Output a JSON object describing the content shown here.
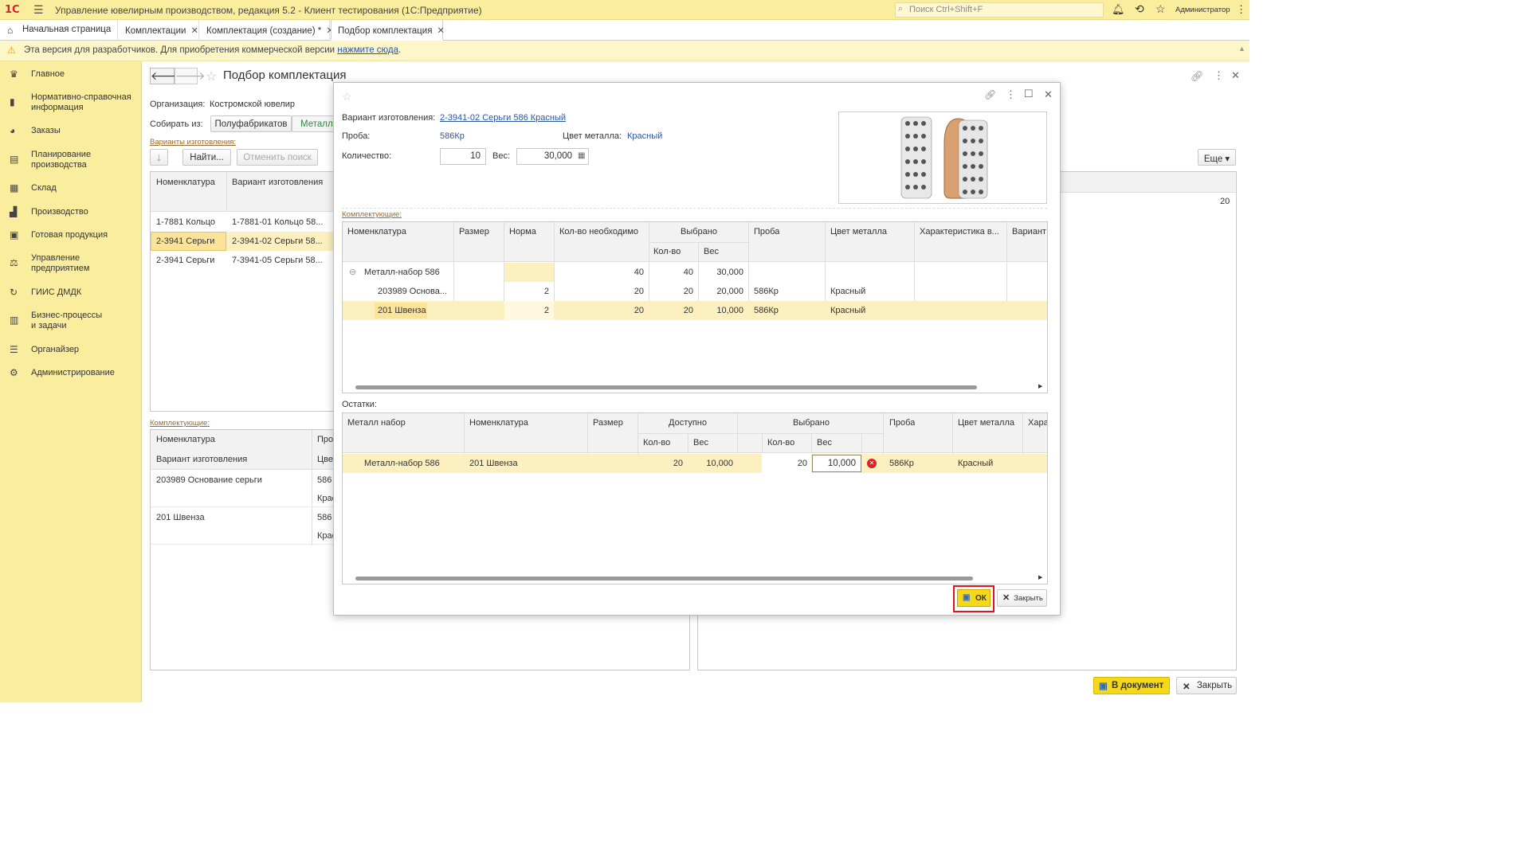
{
  "app": {
    "logo": "1С",
    "title": "Управление ювелирным производством, редакция 5.2  - Клиент тестирования (1С:Предприятие)",
    "search_placeholder": "Поиск Ctrl+Shift+F",
    "user": "Администратор"
  },
  "tabs": [
    {
      "label": "Начальная страница"
    },
    {
      "label": "Комплектации"
    },
    {
      "label": "Комплектация (создание) *"
    },
    {
      "label": "Подбор комплектация"
    }
  ],
  "warning": {
    "text": "Эта версия для разработчиков. Для приобретения коммерческой версии ",
    "link": "нажмите сюда",
    "end": "."
  },
  "sidebar": {
    "items": [
      {
        "label": "Главное",
        "icon": "crown-icon"
      },
      {
        "label": "Нормативно-справочная информация",
        "icon": "book-icon"
      },
      {
        "label": "Заказы",
        "icon": "pie-icon"
      },
      {
        "label": "Планирование производства",
        "icon": "clipboard-icon"
      },
      {
        "label": "Склад",
        "icon": "grid-icon"
      },
      {
        "label": "Производство",
        "icon": "factory-icon"
      },
      {
        "label": "Готовая продукция",
        "icon": "bag-icon"
      },
      {
        "label": "Управление предприятием",
        "icon": "org-icon"
      },
      {
        "label": "ГИИС ДМДК",
        "icon": "sync-icon"
      },
      {
        "label": "Бизнес-процессы и задачи",
        "icon": "tasks-icon"
      },
      {
        "label": "Органайзер",
        "icon": "list-icon"
      },
      {
        "label": "Администрирование",
        "icon": "gear-icon"
      }
    ]
  },
  "form": {
    "title": "Подбор комплектация",
    "org_label": "Организация:",
    "org_value": "Костромской ювелир",
    "collect_label": "Собирать из:",
    "collect_tab1": "Полуфабрикатов",
    "collect_tab2": "Металл-",
    "variants_label": "Варианты изготовления:",
    "find_btn": "Найти...",
    "cancel_search_btn": "Отменить поиск",
    "more_btn": "Еще",
    "variants_cols": [
      "Номенклатура",
      "Вариант изготовления"
    ],
    "variants_rows": [
      [
        "1-7881 Кольцо",
        "1-7881-01 Кольцо 58..."
      ],
      [
        "2-3941 Серьги",
        "2-3941-02 Серьги 58..."
      ],
      [
        "2-3941 Серьги",
        "7-3941-05 Серьги 58..."
      ]
    ],
    "components_label": "Комплектующие:",
    "comp_cols": [
      "Номенклатура",
      "Про"
    ],
    "comp_sub": [
      "Вариант изготовления",
      "Цвет"
    ],
    "comp_rows": [
      [
        "203989 Основание серьги",
        "586",
        "Крас"
      ],
      [
        "201 Швенза",
        "586",
        "Крас"
      ]
    ],
    "right_value": "20",
    "to_doc_btn": "В документ",
    "close_btn": "Закрыть"
  },
  "dialog": {
    "variant_label": "Вариант изготовления:",
    "variant_value": "2-3941-02 Серьги 586 Красный",
    "proba_label": "Проба:",
    "proba_value": "586Кр",
    "color_label": "Цвет металла:",
    "color_value": "Красный",
    "qty_label": "Количество:",
    "qty_value": "10",
    "weight_label": "Вес:",
    "weight_value": "30,000",
    "components_label": "Комплектующие:",
    "comp_headers": {
      "nom": "Номенклатура",
      "size": "Размер",
      "norm": "Норма",
      "need": "Кол-во  необходимо",
      "selected": "Выбрано",
      "sel_qty": "Кол-во",
      "sel_weight": "Вес",
      "proba": "Проба",
      "color": "Цвет металла",
      "char": "Характеристика в...",
      "variant": "Вариант"
    },
    "comp_rows": [
      {
        "nom": "Металл-набор 586",
        "size": "",
        "norm": "",
        "need": "40",
        "qty": "40",
        "weight": "30,000",
        "proba": "",
        "color": ""
      },
      {
        "nom": "203989 Основа...",
        "size": "",
        "norm": "2",
        "need": "20",
        "qty": "20",
        "weight": "20,000",
        "proba": "586Кр",
        "color": "Красный"
      },
      {
        "nom": "201 Швенза",
        "size": "",
        "norm": "2",
        "need": "20",
        "qty": "20",
        "weight": "10,000",
        "proba": "586Кр",
        "color": "Красный"
      }
    ],
    "remains_label": "Остатки:",
    "rem_headers": {
      "set": "Металл набор",
      "nom": "Номенклатура",
      "size": "Размер",
      "avail": "Доступно",
      "avail_qty": "Кол-во",
      "avail_weight": "Вес",
      "sel": "Выбрано",
      "sel_qty": "Кол-во",
      "sel_weight": "Вес",
      "proba": "Проба",
      "color": "Цвет металла",
      "char": "Хара"
    },
    "rem_rows": [
      {
        "set": "Металл-набор 586",
        "nom": "201 Швенза",
        "size": "",
        "aqty": "20",
        "aweight": "10,000",
        "sqty": "20",
        "sweight": "10,000",
        "proba": "586Кр",
        "color": "Красный"
      }
    ],
    "ok_btn": "ОК",
    "close_btn": "Закрыть"
  },
  "colors": {
    "accent_yellow": "#fbed9e",
    "highlight_row": "#fdf0c0",
    "ok_btn": "#f5d81a",
    "red_frame": "#e0141e",
    "link": "#2a55a6"
  }
}
